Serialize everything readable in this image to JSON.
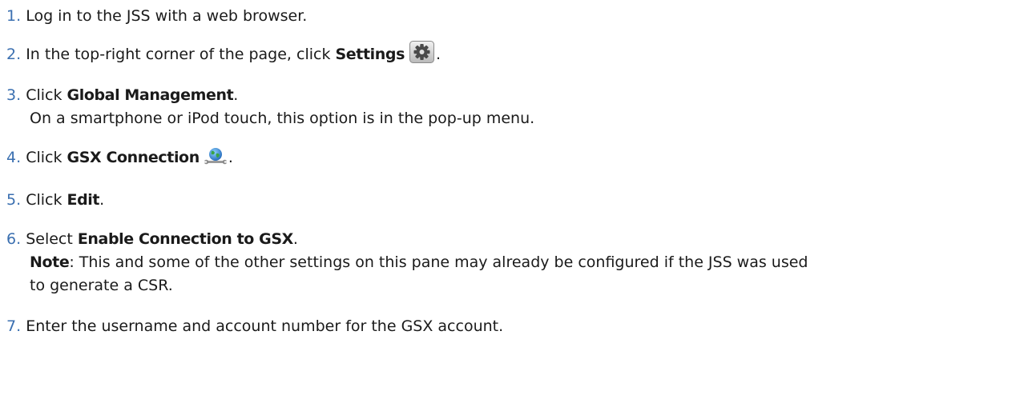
{
  "steps": [
    {
      "num": "1.",
      "pre": "Log in to the JSS with a web browser."
    },
    {
      "num": "2.",
      "pre": "In the top-right corner of the page, click ",
      "bold": "Settings",
      "post": ".",
      "icon": "gear-icon"
    },
    {
      "num": "3.",
      "pre": "Click ",
      "bold": "Global Management",
      "post": ".",
      "sub": "On a smartphone or iPod touch, this option is in the pop-up menu."
    },
    {
      "num": "4.",
      "pre": "Click ",
      "bold": "GSX Connection",
      "post": ".",
      "icon": "globe-wrench-icon"
    },
    {
      "num": "5.",
      "pre": "Click ",
      "bold": "Edit",
      "post": "."
    },
    {
      "num": "6.",
      "pre": "Select ",
      "bold": "Enable Connection to GSX",
      "post": ".",
      "note_label": "Note",
      "note_text": ": This and some of the other settings on this pane may already be configured if the JSS was used",
      "note_text2": "to generate a CSR."
    },
    {
      "num": "7.",
      "pre": "Enter the username and account number for the GSX account."
    }
  ]
}
